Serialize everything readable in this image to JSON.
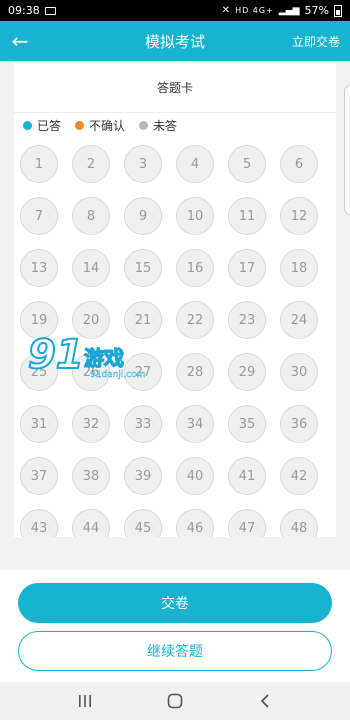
{
  "status_bar": {
    "time": "09:38",
    "signal_text": "HD 4G+",
    "battery": "57%"
  },
  "header": {
    "title": "模拟考试",
    "submit_now_label": "立即交卷",
    "back_icon": "arrow-left-icon"
  },
  "card": {
    "title": "答题卡",
    "legend": [
      {
        "label": "已答",
        "color": "#1ab3cf"
      },
      {
        "label": "不确认",
        "color": "#f08a24"
      },
      {
        "label": "未答",
        "color": "#b8b8b8"
      }
    ],
    "questions": [
      "1",
      "2",
      "3",
      "4",
      "5",
      "6",
      "7",
      "8",
      "9",
      "10",
      "11",
      "12",
      "13",
      "14",
      "15",
      "16",
      "17",
      "18",
      "19",
      "20",
      "21",
      "22",
      "23",
      "24",
      "25",
      "26",
      "27",
      "28",
      "29",
      "30",
      "31",
      "32",
      "33",
      "34",
      "35",
      "36",
      "37",
      "38",
      "39",
      "40",
      "41",
      "42",
      "43",
      "44",
      "45",
      "46",
      "47",
      "48"
    ]
  },
  "watermark": {
    "number": "91",
    "text": "游戏",
    "url": "91danji.com"
  },
  "bottom": {
    "submit_label": "交卷",
    "continue_label": "继续答题"
  },
  "navbar": {
    "recents_icon": "recents-icon",
    "home_icon": "home-icon",
    "back_icon": "back-icon"
  }
}
